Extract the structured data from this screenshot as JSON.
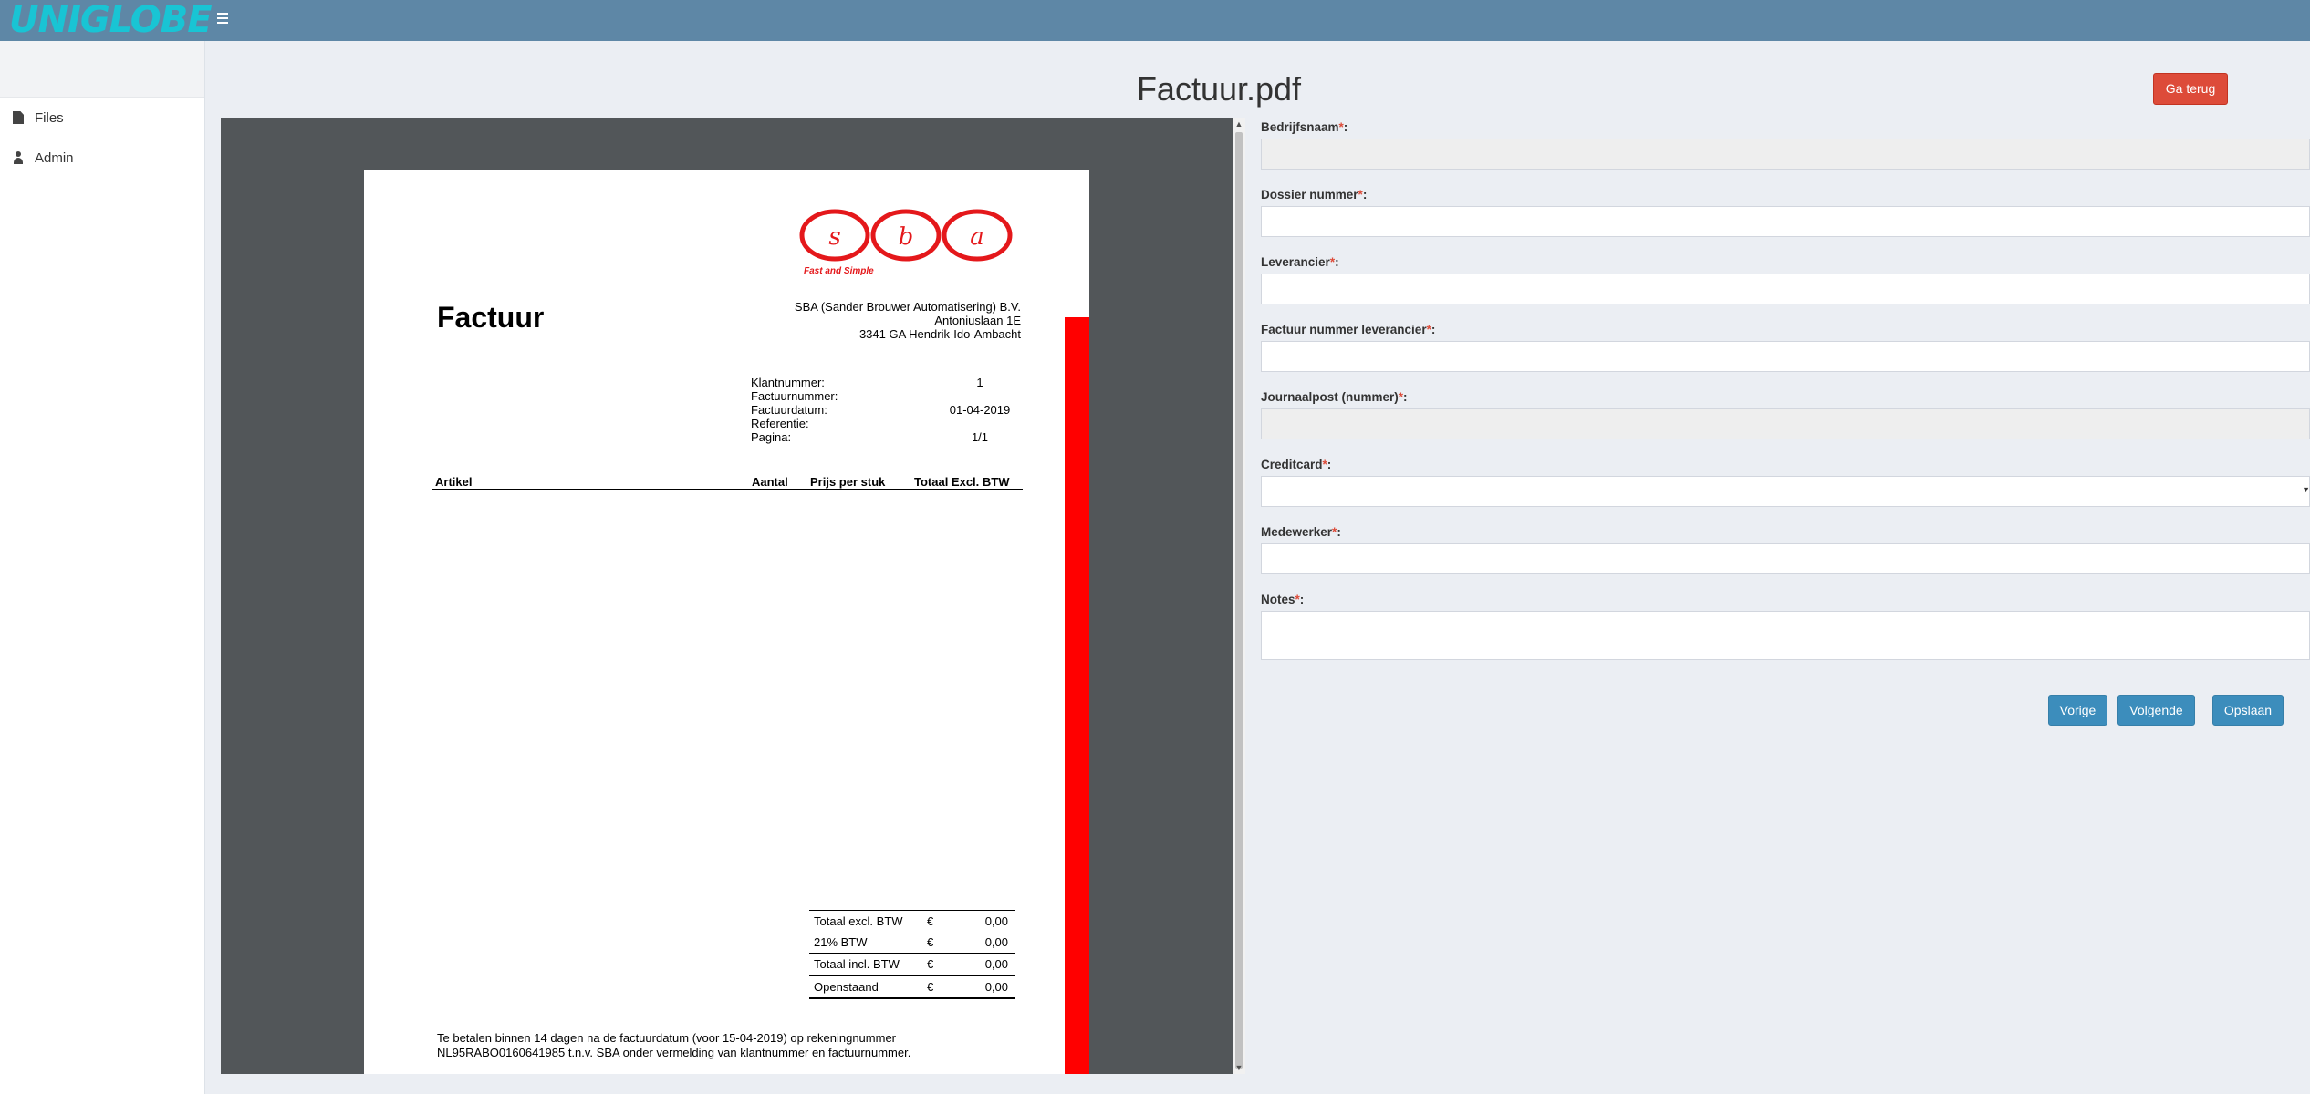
{
  "brand": {
    "logo_text": "UNIGLOBE"
  },
  "sidebar": {
    "items": [
      {
        "label": "Files",
        "icon": "file-icon"
      },
      {
        "label": "Admin",
        "icon": "user-icon"
      }
    ]
  },
  "page": {
    "title": "Factuur.pdf",
    "back_label": "Ga terug"
  },
  "pdf": {
    "logo_letters": [
      "s",
      "b",
      "a"
    ],
    "logo_tagline": "Fast and Simple",
    "heading": "Factuur",
    "sender": [
      "SBA (Sander Brouwer Automatisering) B.V.",
      "Antoniuslaan 1E",
      "3341 GA Hendrik-Ido-Ambacht"
    ],
    "meta": [
      {
        "label": "Klantnummer:",
        "value": "1"
      },
      {
        "label": "Factuurnummer:",
        "value": ""
      },
      {
        "label": "Factuurdatum:",
        "value": "01-04-2019"
      },
      {
        "label": "Referentie:",
        "value": ""
      },
      {
        "label": "Pagina:",
        "value": "1/1"
      }
    ],
    "table_headers": {
      "artikel": "Artikel",
      "aantal": "Aantal",
      "prijs": "Prijs per stuk",
      "totaal": "Totaal Excl. BTW"
    },
    "totals": [
      {
        "label": "Totaal excl. BTW",
        "currency": "€",
        "value": "0,00"
      },
      {
        "label": "21% BTW",
        "currency": "€",
        "value": "0,00"
      },
      {
        "label": "Totaal incl. BTW",
        "currency": "€",
        "value": "0,00"
      },
      {
        "label": "Openstaand",
        "currency": "€",
        "value": "0,00"
      }
    ],
    "footer": [
      "Te betalen binnen 14 dagen na de factuurdatum (voor 15-04-2019) op rekeningnummer",
      "NL95RABO0160641985 t.n.v. SBA onder vermelding van klantnummer en factuurnummer."
    ]
  },
  "form": {
    "fields": [
      {
        "label": "Bedrijfsnaam",
        "value": ""
      },
      {
        "label": "Dossier nummer",
        "value": ""
      },
      {
        "label": "Leverancier",
        "value": ""
      },
      {
        "label": "Factuur nummer leverancier",
        "value": ""
      },
      {
        "label": "Journaalpost (nummer)",
        "value": ""
      },
      {
        "label": "Creditcard",
        "value": ""
      },
      {
        "label": "Medewerker",
        "value": ""
      },
      {
        "label": "Notes",
        "value": ""
      }
    ],
    "required_marker": "*",
    "colon": ":",
    "buttons": {
      "prev": "Vorige",
      "next": "Volgende",
      "save": "Opslaan"
    }
  },
  "colors": {
    "topbar": "#5e87a6",
    "accent_blue": "#3c8dbc",
    "danger": "#dd4b39",
    "logo": "#19c4d4",
    "pdf_red": "#ff0000"
  }
}
